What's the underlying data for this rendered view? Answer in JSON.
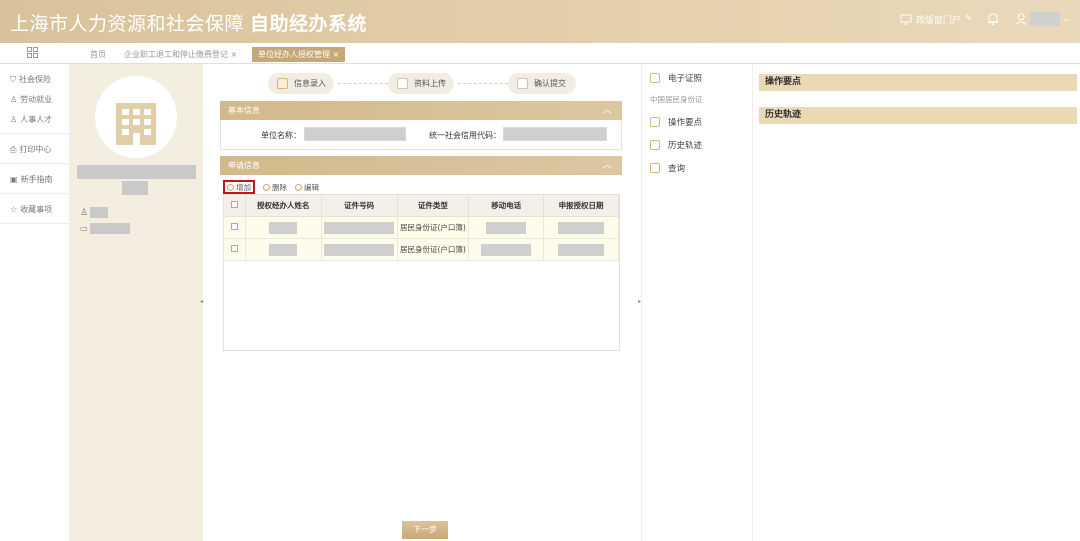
{
  "header": {
    "title_main": "上海市人力资源和社会保障",
    "title_bold": "自助经办系统",
    "portal_label": "政版窗门户",
    "bell_icon": "bell-icon",
    "user_icon": "user-icon"
  },
  "tabs": [
    {
      "label": "首页"
    },
    {
      "label": "企业职工退工和停止缴费登记"
    },
    {
      "label": "单位经办人授权管理"
    }
  ],
  "sidebar": {
    "items": [
      {
        "label": "社会保险",
        "icon": "shield-icon"
      },
      {
        "label": "劳动就业",
        "icon": "person-icon"
      },
      {
        "label": "人事人才",
        "icon": "people-icon"
      },
      {
        "label": "打印中心",
        "icon": "printer-icon"
      },
      {
        "label": "新手指南",
        "icon": "guide-icon"
      },
      {
        "label": "收藏事项",
        "icon": "star-icon"
      }
    ]
  },
  "steps": [
    {
      "label": "信息录入"
    },
    {
      "label": "资料上传"
    },
    {
      "label": "确认提交"
    }
  ],
  "basic_info": {
    "title": "基本信息",
    "unit_name_label": "单位名称：",
    "credit_code_label": "统一社会信用代码："
  },
  "apply_info": {
    "title": "申请信息",
    "add_label": "增加",
    "delete_label": "删除",
    "edit_label": "编辑",
    "columns": [
      "授权经办人姓名",
      "证件号码",
      "证件类型",
      "移动电话",
      "申报授权日期"
    ],
    "rows": [
      {
        "id_type": "居民身份证(户口簿)"
      },
      {
        "id_type": "居民身份证(户口簿)"
      }
    ]
  },
  "next_button": "下一步",
  "right_menu": {
    "items": [
      {
        "label": "电子证照"
      },
      {
        "label": "操作要点"
      },
      {
        "label": "历史轨迹"
      },
      {
        "label": "查询"
      }
    ],
    "sub_label": "中国居民身份证"
  },
  "right_panel": {
    "op_points": "操作要点",
    "history": "历史轨迹"
  }
}
